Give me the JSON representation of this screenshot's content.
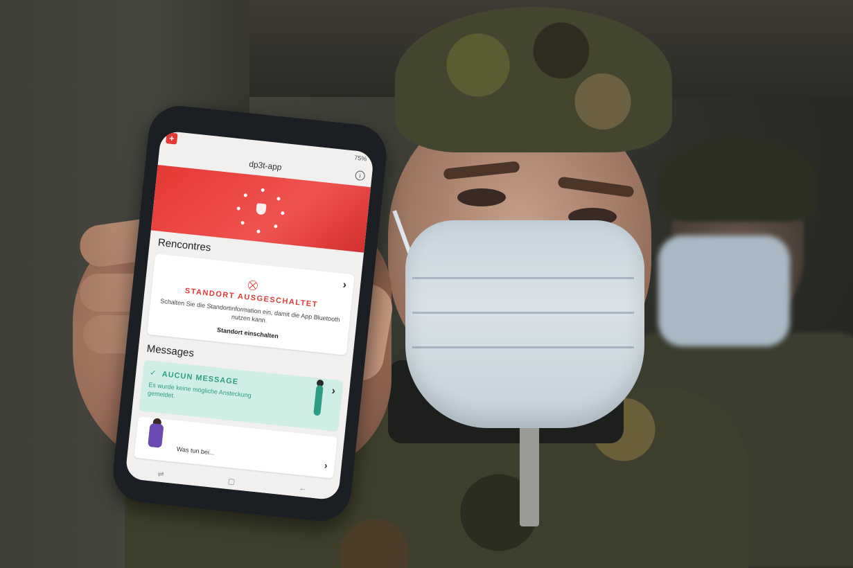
{
  "app": {
    "title": "dp3t-app",
    "logo_glyph": "+",
    "info_glyph": "i"
  },
  "status_bar": {
    "left": "",
    "right": "75%"
  },
  "sections": {
    "encounters": {
      "title": "Rencontres",
      "warning_title": "STANDORT AUSGESCHALTET",
      "warning_text": "Schalten Sie die Standortinformation ein, damit die App Bluetooth nutzen kann.",
      "action_label": "Standort einschalten"
    },
    "messages": {
      "title": "Messages",
      "status_title": "AUCUN MESSAGE",
      "status_text": "Es wurde keine mögliche Ansteckung gemeldet."
    },
    "what_to_do": {
      "label": "Was tun bei..."
    }
  },
  "navbar": {
    "recent": "⇌",
    "home": "▢",
    "back": "←"
  },
  "colors": {
    "hero_red": "#e53935",
    "message_green": "#2e9c83",
    "message_bg": "#cfeee6"
  }
}
